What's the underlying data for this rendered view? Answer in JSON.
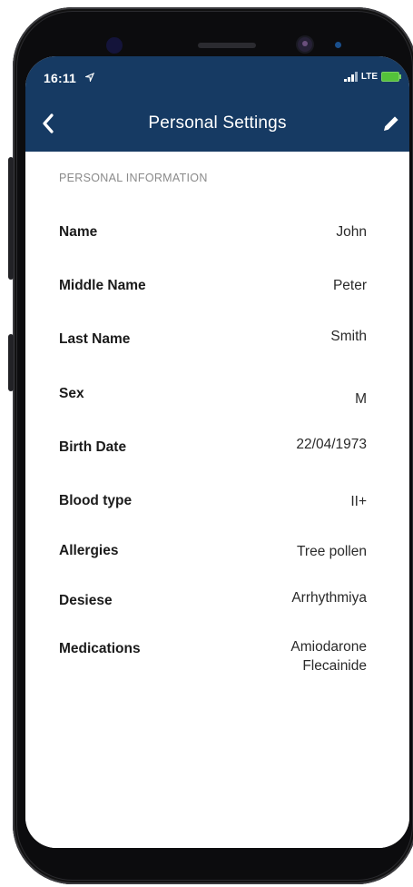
{
  "status_bar": {
    "time": "16:11",
    "network": "LTE"
  },
  "header": {
    "title": "Personal Settings",
    "back_icon": "chevron-left-icon",
    "edit_icon": "pencil-icon",
    "background": "#163a63"
  },
  "section": {
    "title": "PERSONAL INFORMATION"
  },
  "fields": [
    {
      "label": "Name",
      "value": "John"
    },
    {
      "label": "Middle Name",
      "value": "Peter"
    },
    {
      "label": "Last Name",
      "value": "Smith"
    },
    {
      "label": "Sex",
      "value": "M"
    },
    {
      "label": "Birth Date",
      "value": "22/04/1973"
    },
    {
      "label": "Blood type",
      "value": "II+"
    },
    {
      "label": "Allergies",
      "value": "Tree pollen"
    },
    {
      "label": "Desiese",
      "value": "Arrhythmiya"
    },
    {
      "label": "Medications",
      "value": "Amiodarone",
      "value_2": "Flecainide"
    }
  ]
}
